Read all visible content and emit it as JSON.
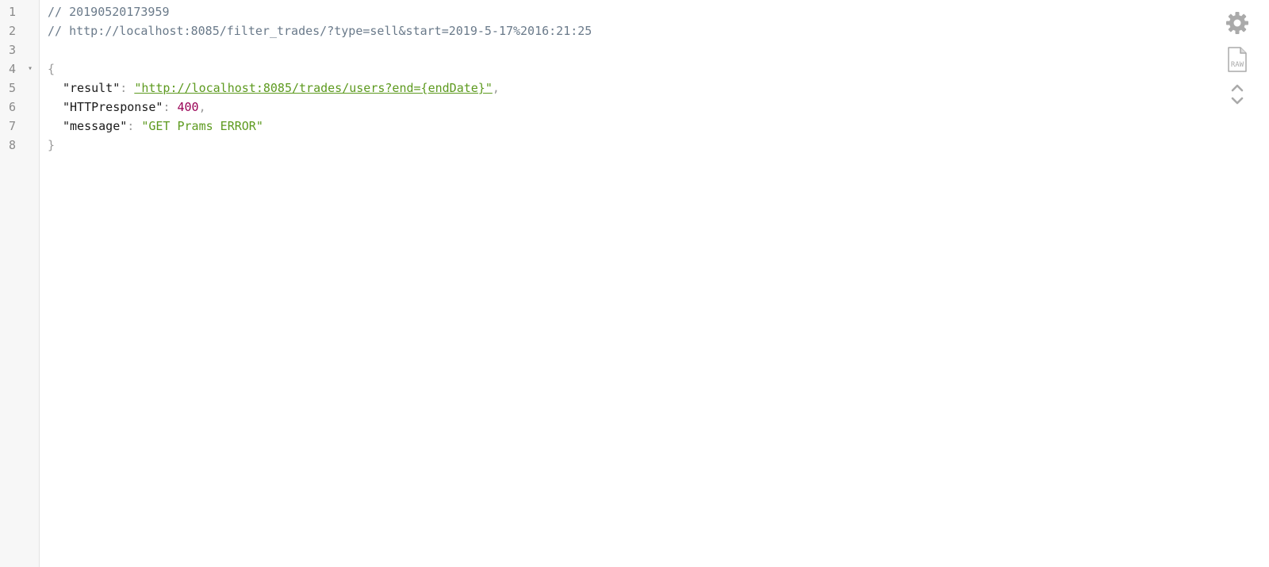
{
  "viewer": {
    "lines": [
      {
        "number": "1"
      },
      {
        "number": "2"
      },
      {
        "number": "3"
      },
      {
        "number": "4",
        "fold": "▾"
      },
      {
        "number": "5"
      },
      {
        "number": "6"
      },
      {
        "number": "7"
      },
      {
        "number": "8"
      }
    ],
    "comments": [
      "// 20190520173959",
      "// http://localhost:8085/filter_trades/?type=sell&start=2019-5-17%2016:21:25"
    ],
    "open_brace": "{",
    "close_brace": "}",
    "entries": [
      {
        "key": "\"result\"",
        "value": "\"http://localhost:8085/trades/users?end={endDate}\"",
        "value_type": "link",
        "comma": ","
      },
      {
        "key": "\"HTTPresponse\"",
        "value": "400",
        "value_type": "number",
        "comma": ","
      },
      {
        "key": "\"message\"",
        "value": "\"GET Prams ERROR\"",
        "value_type": "string",
        "comma": ""
      }
    ],
    "colon": ": "
  },
  "toolbar": {
    "settings_icon": "gear-icon",
    "raw_icon": "raw-file-icon",
    "raw_label": "RAW",
    "collapse_icon": "chevron-up-icon",
    "expand_icon": "chevron-down-icon"
  },
  "colors": {
    "gutter_bg": "#f7f7f7",
    "comment": "#6a7a8a",
    "string": "#5d9a1f",
    "number": "#990055",
    "icon": "#aaaaaa"
  }
}
